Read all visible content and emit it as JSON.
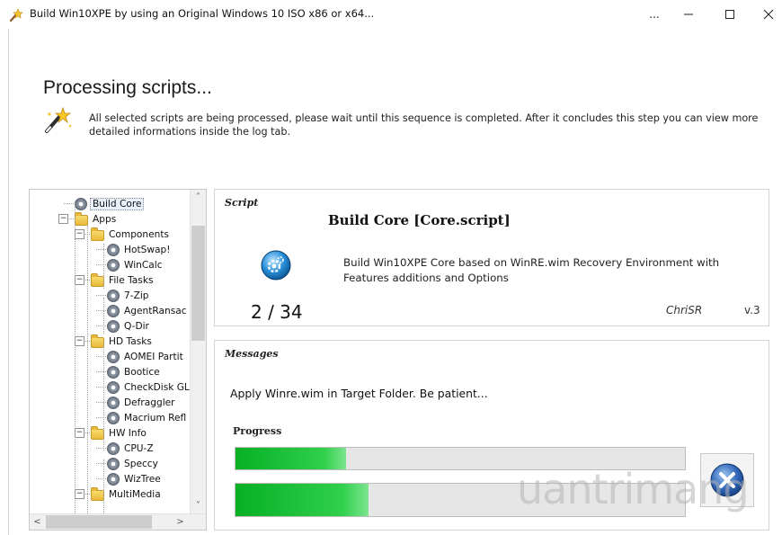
{
  "window": {
    "title": "Build Win10XPE by using an Original Windows 10 ISO x86 or x64...",
    "more_label": "...",
    "minimize_glyph": "—",
    "maximize_glyph": "☐",
    "close_glyph": "✕"
  },
  "header": {
    "heading": "Processing scripts...",
    "description": "All selected scripts are being processed, please wait until this sequence is completed. After it concludes this step you can view more detailed informations inside the log tab."
  },
  "tree": {
    "items": [
      {
        "label": "Build Core",
        "type": "script",
        "selected": true
      },
      {
        "label": "Apps",
        "type": "folder"
      },
      {
        "label": "Components",
        "type": "folder"
      },
      {
        "label": "HotSwap!",
        "type": "script"
      },
      {
        "label": "WinCalc",
        "type": "script"
      },
      {
        "label": "File Tasks",
        "type": "folder"
      },
      {
        "label": "7-Zip",
        "type": "script"
      },
      {
        "label": "AgentRansac",
        "type": "script"
      },
      {
        "label": "Q-Dir",
        "type": "script"
      },
      {
        "label": "HD Tasks",
        "type": "folder"
      },
      {
        "label": "AOMEI Partit",
        "type": "script"
      },
      {
        "label": "Bootice",
        "type": "script"
      },
      {
        "label": "CheckDisk GL",
        "type": "script"
      },
      {
        "label": "Defraggler",
        "type": "script"
      },
      {
        "label": "Macrium Refl",
        "type": "script"
      },
      {
        "label": "HW Info",
        "type": "folder"
      },
      {
        "label": "CPU-Z",
        "type": "script"
      },
      {
        "label": "Speccy",
        "type": "script"
      },
      {
        "label": "WizTree",
        "type": "script"
      },
      {
        "label": "MultiMedia",
        "type": "folder"
      }
    ],
    "scroll_up": "˄",
    "scroll_down": "˅",
    "scroll_left": "<",
    "scroll_right": ">"
  },
  "script": {
    "section_title": "Script",
    "name": "Build Core [Core.script]",
    "description": "Build Win10XPE Core based on WinRE.wim Recovery Environment with Features additions and Options",
    "counter": "2 / 34",
    "author": "ChriSR",
    "version": "v.3",
    "icon": "gear-globe-icon"
  },
  "messages": {
    "section_title": "Messages",
    "status": "Apply Winre.wim in Target Folder. Be patient...",
    "progress_label": "Progress",
    "progress_overall": 0.245,
    "progress_current": 0.295,
    "cancel_icon": "cancel-x-icon"
  },
  "watermark": "uantrimang",
  "colors": {
    "progress_green": "#06b025",
    "cancel_blue": "#2f66b8"
  }
}
